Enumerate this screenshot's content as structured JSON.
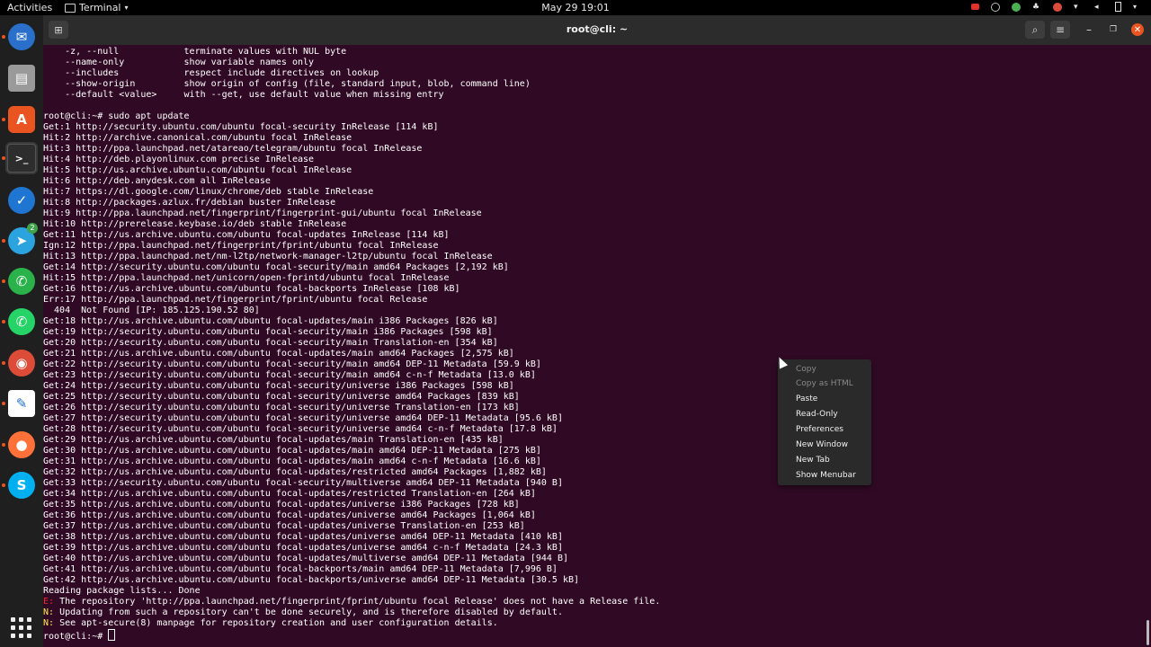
{
  "topbar": {
    "activities": "Activities",
    "app_name": "Terminal",
    "app_menu_icon": "chevron-down-icon",
    "clock": "May 29  19:01",
    "tray_icons": [
      "camera-icon",
      "whatsapp-icon",
      "vpn-icon",
      "notification-icon",
      "chrome-icon",
      "wifi-icon",
      "volume-icon",
      "battery-icon",
      "chevron-down-icon"
    ]
  },
  "dock": {
    "items": [
      {
        "name": "thunderbird-icon",
        "glyph": "✉",
        "color": "#2a6fc9"
      },
      {
        "name": "files-icon",
        "glyph": "▤",
        "color": "#9a9a9a"
      },
      {
        "name": "software-icon",
        "glyph": "A",
        "color": "#e95420"
      },
      {
        "name": "terminal-icon",
        "glyph": ">_",
        "color": "#2d2d2d"
      },
      {
        "name": "browser-icon",
        "glyph": "✓",
        "color": "#1f76d2"
      },
      {
        "name": "telegram-icon",
        "glyph": "➤",
        "color": "#2aa3df"
      },
      {
        "name": "whatsapp-icon",
        "glyph": "✆",
        "color": "#29b34a"
      },
      {
        "name": "whatsapp-icon",
        "glyph": "✆",
        "color": "#25d366"
      },
      {
        "name": "chrome-icon",
        "glyph": "◉",
        "color": "#dd4b39"
      },
      {
        "name": "text-editor-icon",
        "glyph": "✎",
        "color": "#ffffff"
      },
      {
        "name": "firefox-icon",
        "glyph": "●",
        "color": "#ff7139"
      },
      {
        "name": "skype-icon",
        "glyph": "S",
        "color": "#00aff0"
      }
    ],
    "telegram_badge": "2",
    "apps_grid_icon": "apps-grid-icon"
  },
  "window": {
    "title": "root@cli: ~",
    "new_tab_icon": "new-tab-icon",
    "search_icon": "search-icon",
    "menu_icon": "hamburger-menu-icon",
    "minimize_icon": "minimize-icon",
    "maximize_icon": "maximize-icon",
    "close_icon": "close-icon"
  },
  "terminal": {
    "lines": [
      "    -z, --null            terminate values with NUL byte",
      "    --name-only           show variable names only",
      "    --includes            respect include directives on lookup",
      "    --show-origin         show origin of config (file, standard input, blob, command line)",
      "    --default <value>     with --get, use default value when missing entry",
      "",
      "root@cli:~# sudo apt update",
      "Get:1 http://security.ubuntu.com/ubuntu focal-security InRelease [114 kB]",
      "Hit:2 http://archive.canonical.com/ubuntu focal InRelease",
      "Hit:3 http://ppa.launchpad.net/atareao/telegram/ubuntu focal InRelease",
      "Hit:4 http://deb.playonlinux.com precise InRelease",
      "Hit:5 http://us.archive.ubuntu.com/ubuntu focal InRelease",
      "Hit:6 http://deb.anydesk.com all InRelease",
      "Hit:7 https://dl.google.com/linux/chrome/deb stable InRelease",
      "Hit:8 http://packages.azlux.fr/debian buster InRelease",
      "Hit:9 http://ppa.launchpad.net/fingerprint/fingerprint-gui/ubuntu focal InRelease",
      "Hit:10 http://prerelease.keybase.io/deb stable InRelease",
      "Get:11 http://us.archive.ubuntu.com/ubuntu focal-updates InRelease [114 kB]",
      "Ign:12 http://ppa.launchpad.net/fingerprint/fprint/ubuntu focal InRelease",
      "Hit:13 http://ppa.launchpad.net/nm-l2tp/network-manager-l2tp/ubuntu focal InRelease",
      "Get:14 http://security.ubuntu.com/ubuntu focal-security/main amd64 Packages [2,192 kB]",
      "Hit:15 http://ppa.launchpad.net/unicorn/open-fprintd/ubuntu focal InRelease",
      "Get:16 http://us.archive.ubuntu.com/ubuntu focal-backports InRelease [108 kB]",
      "Err:17 http://ppa.launchpad.net/fingerprint/fprint/ubuntu focal Release",
      "  404  Not Found [IP: 185.125.190.52 80]",
      "Get:18 http://us.archive.ubuntu.com/ubuntu focal-updates/main i386 Packages [826 kB]",
      "Get:19 http://security.ubuntu.com/ubuntu focal-security/main i386 Packages [598 kB]",
      "Get:20 http://security.ubuntu.com/ubuntu focal-security/main Translation-en [354 kB]",
      "Get:21 http://us.archive.ubuntu.com/ubuntu focal-updates/main amd64 Packages [2,575 kB]",
      "Get:22 http://security.ubuntu.com/ubuntu focal-security/main amd64 DEP-11 Metadata [59.9 kB]",
      "Get:23 http://security.ubuntu.com/ubuntu focal-security/main amd64 c-n-f Metadata [13.0 kB]",
      "Get:24 http://security.ubuntu.com/ubuntu focal-security/universe i386 Packages [598 kB]",
      "Get:25 http://security.ubuntu.com/ubuntu focal-security/universe amd64 Packages [839 kB]",
      "Get:26 http://security.ubuntu.com/ubuntu focal-security/universe Translation-en [173 kB]",
      "Get:27 http://security.ubuntu.com/ubuntu focal-security/universe amd64 DEP-11 Metadata [95.6 kB]",
      "Get:28 http://security.ubuntu.com/ubuntu focal-security/universe amd64 c-n-f Metadata [17.8 kB]",
      "Get:29 http://us.archive.ubuntu.com/ubuntu focal-updates/main Translation-en [435 kB]",
      "Get:30 http://us.archive.ubuntu.com/ubuntu focal-updates/main amd64 DEP-11 Metadata [275 kB]",
      "Get:31 http://us.archive.ubuntu.com/ubuntu focal-updates/main amd64 c-n-f Metadata [16.6 kB]",
      "Get:32 http://us.archive.ubuntu.com/ubuntu focal-updates/restricted amd64 Packages [1,882 kB]",
      "Get:33 http://security.ubuntu.com/ubuntu focal-security/multiverse amd64 DEP-11 Metadata [940 B]",
      "Get:34 http://us.archive.ubuntu.com/ubuntu focal-updates/restricted Translation-en [264 kB]",
      "Get:35 http://us.archive.ubuntu.com/ubuntu focal-updates/universe i386 Packages [728 kB]",
      "Get:36 http://us.archive.ubuntu.com/ubuntu focal-updates/universe amd64 Packages [1,064 kB]",
      "Get:37 http://us.archive.ubuntu.com/ubuntu focal-updates/universe Translation-en [253 kB]",
      "Get:38 http://us.archive.ubuntu.com/ubuntu focal-updates/universe amd64 DEP-11 Metadata [410 kB]",
      "Get:39 http://us.archive.ubuntu.com/ubuntu focal-updates/universe amd64 c-n-f Metadata [24.3 kB]",
      "Get:40 http://us.archive.ubuntu.com/ubuntu focal-updates/multiverse amd64 DEP-11 Metadata [944 B]",
      "Get:41 http://us.archive.ubuntu.com/ubuntu focal-backports/main amd64 DEP-11 Metadata [7,996 B]",
      "Get:42 http://us.archive.ubuntu.com/ubuntu focal-backports/universe amd64 DEP-11 Metadata [30.5 kB]",
      "Reading package lists... Done"
    ],
    "error_lines": [
      {
        "prefix": "E:",
        "text": " The repository 'http://ppa.launchpad.net/fingerprint/fprint/ubuntu focal Release' does not have a Release file."
      },
      {
        "prefix": "N:",
        "text": " Updating from such a repository can't be done securely, and is therefore disabled by default."
      },
      {
        "prefix": "N:",
        "text": " See apt-secure(8) manpage for repository creation and user configuration details."
      }
    ],
    "prompt": "root@cli:~# "
  },
  "context_menu": {
    "items": [
      {
        "label": "Copy",
        "enabled": false
      },
      {
        "label": "Copy as HTML",
        "enabled": false
      },
      {
        "label": "Paste",
        "enabled": true
      },
      {
        "label": "Read-Only",
        "enabled": true
      },
      {
        "label": "Preferences",
        "enabled": true
      },
      {
        "label": "New Window",
        "enabled": true
      },
      {
        "label": "New Tab",
        "enabled": true
      },
      {
        "label": "Show Menubar",
        "enabled": true
      }
    ]
  },
  "colors": {
    "terminal_bg": "#300a24",
    "accent": "#e95420",
    "error": "#ef2929",
    "notice": "#fce94f"
  }
}
